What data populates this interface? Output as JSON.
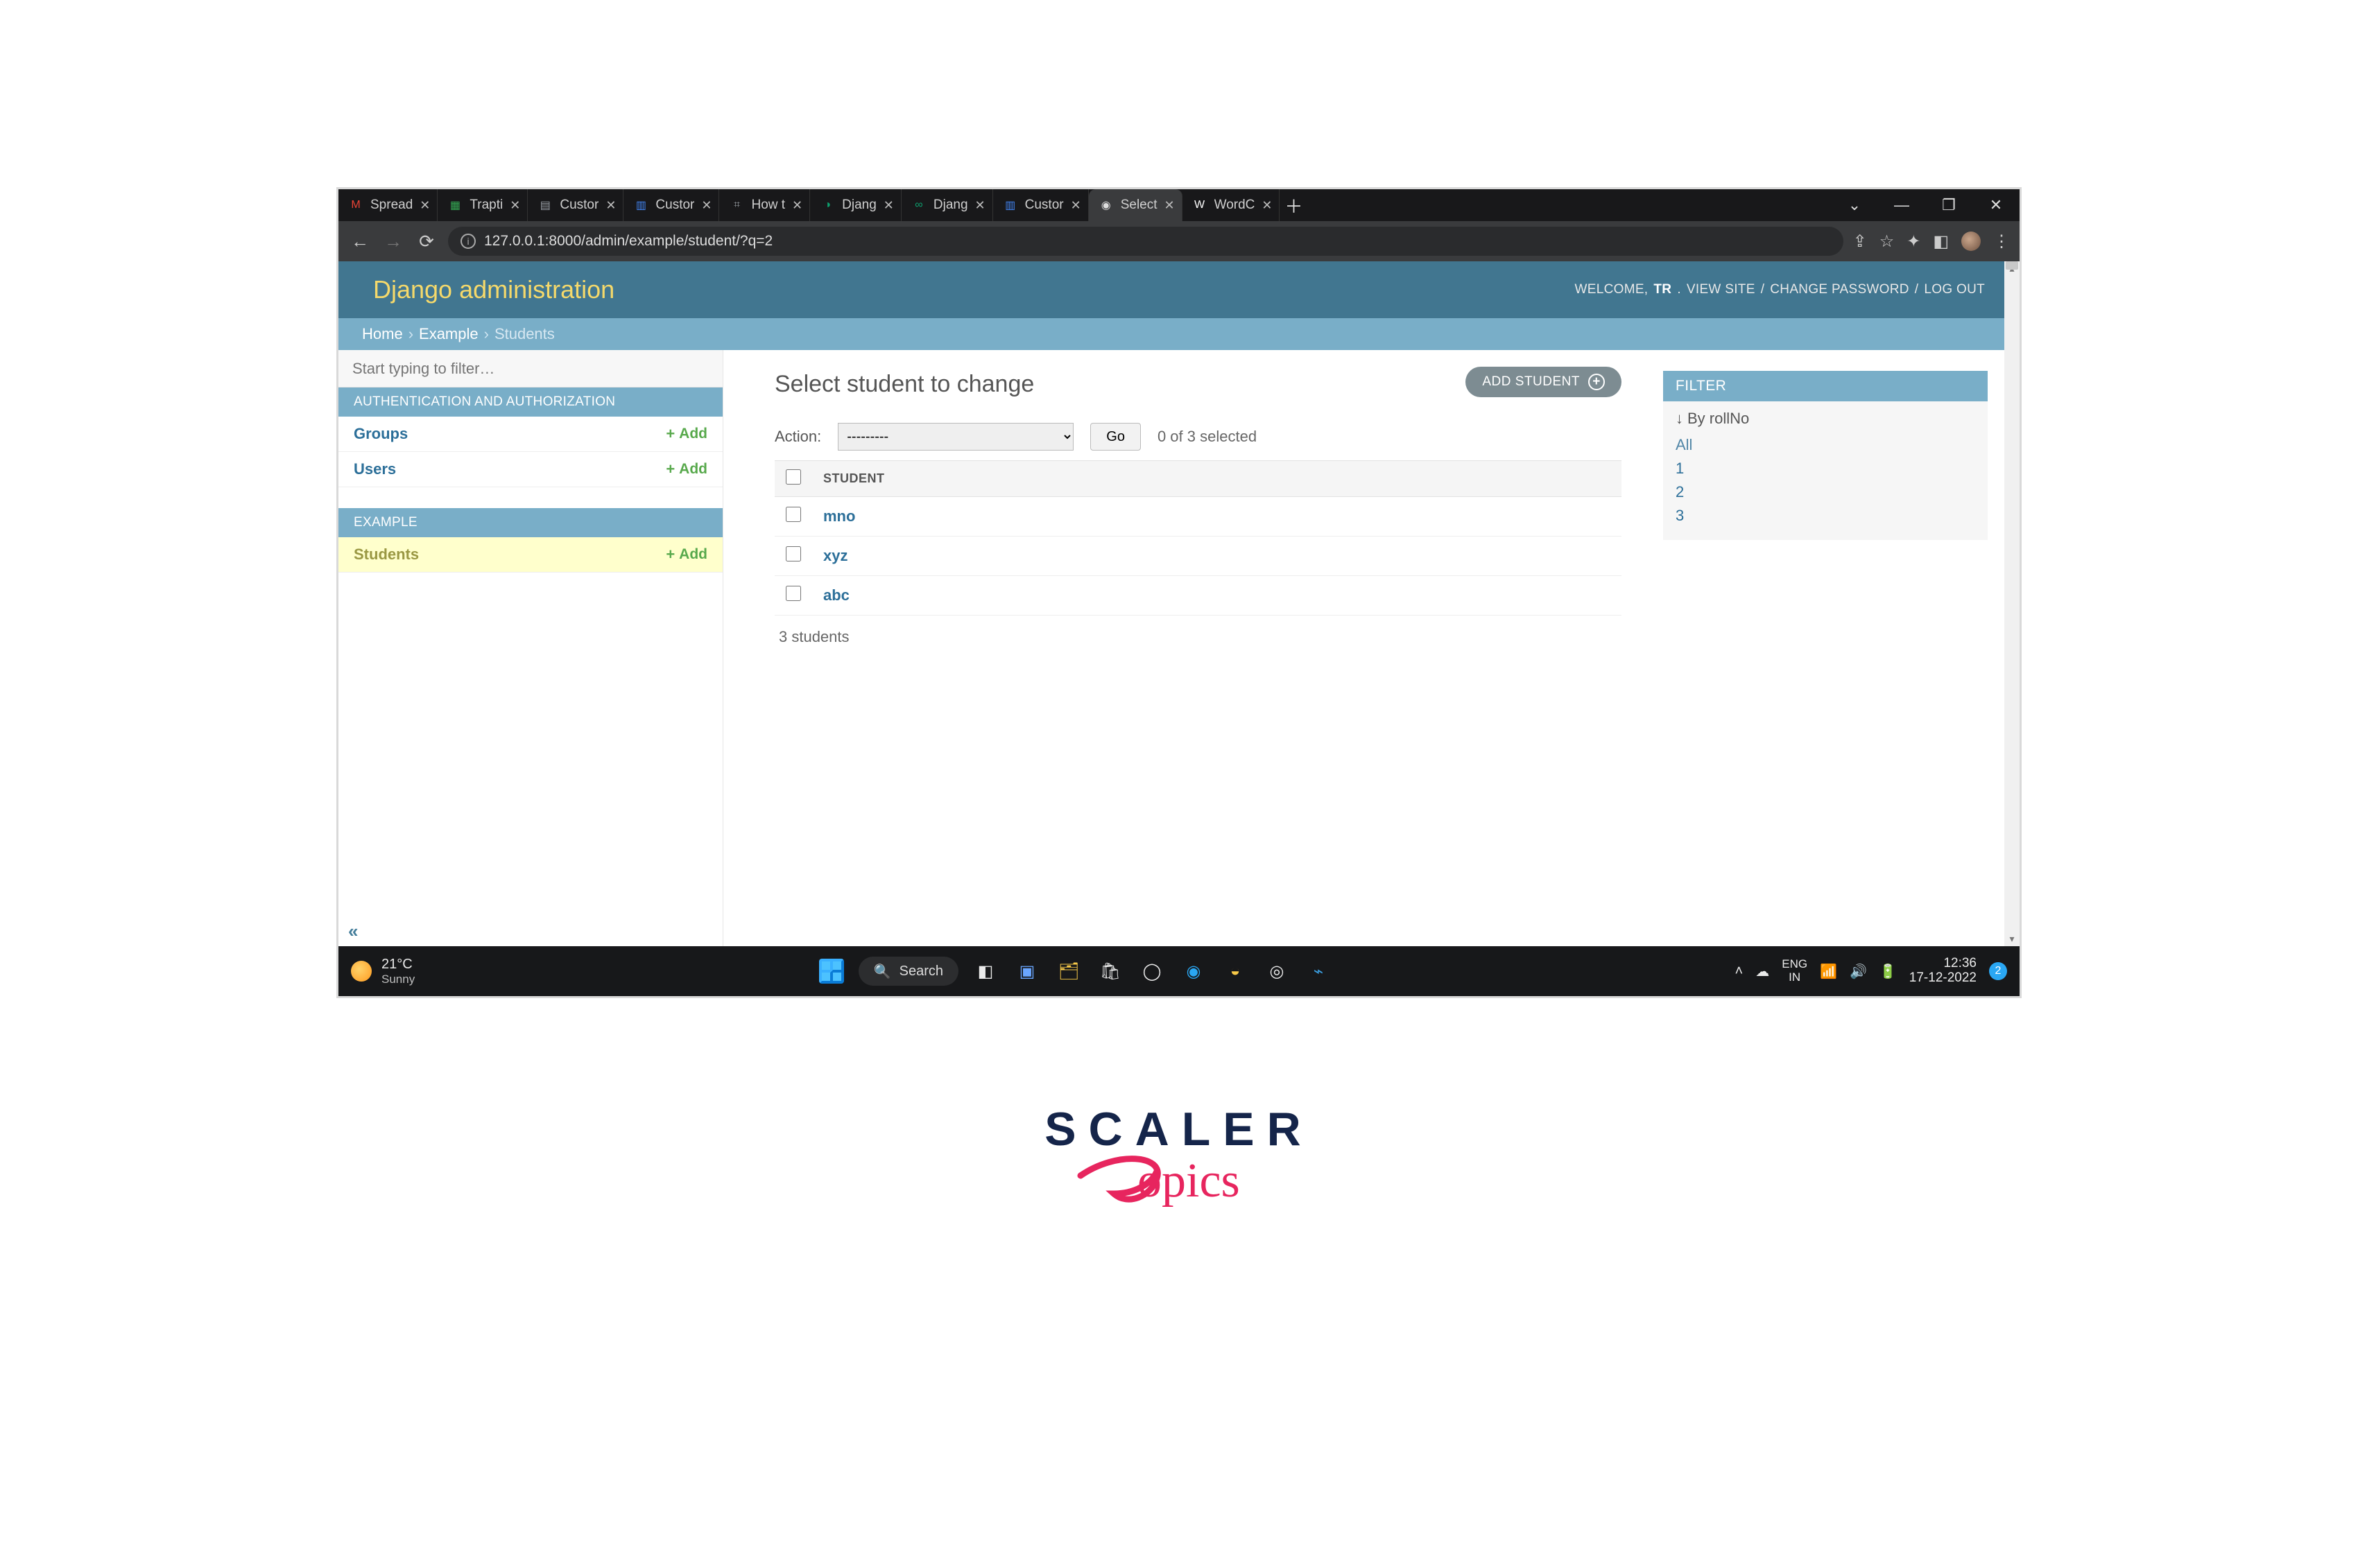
{
  "browser": {
    "tabs": [
      {
        "icon": "M",
        "color": "#ea4335",
        "label": "Spread"
      },
      {
        "icon": "▦",
        "color": "#34a853",
        "label": "Trapti"
      },
      {
        "icon": "▤",
        "color": "#9aa0a6",
        "label": "Custor"
      },
      {
        "icon": "▥",
        "color": "#4285f4",
        "label": "Custor"
      },
      {
        "icon": "⌗",
        "color": "#9aa0a6",
        "label": "How t"
      },
      {
        "icon": "◑",
        "color": "#0d9f6e",
        "label": "Djang"
      },
      {
        "icon": "∞",
        "color": "#0d9f6e",
        "label": "Djang"
      },
      {
        "icon": "▥",
        "color": "#4285f4",
        "label": "Custor"
      },
      {
        "icon": "◉",
        "color": "#ddd",
        "label": "Select",
        "active": true
      },
      {
        "icon": "W",
        "color": "#fff",
        "label": "WordC"
      }
    ],
    "url": "127.0.0.1:8000/admin/example/student/?q=2"
  },
  "header": {
    "brand": "Django administration",
    "welcome": "WELCOME,",
    "username": "TR",
    "view_site": "VIEW SITE",
    "change_password": "CHANGE PASSWORD",
    "logout": "LOG OUT"
  },
  "breadcrumbs": {
    "home": "Home",
    "app": "Example",
    "current": "Students"
  },
  "sidebar": {
    "filter_placeholder": "Start typing to filter…",
    "sections": [
      {
        "title": "AUTHENTICATION AND AUTHORIZATION",
        "models": [
          {
            "name": "Groups",
            "add": "Add"
          },
          {
            "name": "Users",
            "add": "Add"
          }
        ]
      },
      {
        "title": "EXAMPLE",
        "models": [
          {
            "name": "Students",
            "add": "Add",
            "selected": true
          }
        ]
      }
    ],
    "collapse": "«"
  },
  "content": {
    "title": "Select student to change",
    "add_btn": "ADD STUDENT",
    "action_label": "Action:",
    "action_placeholder": "---------",
    "go": "Go",
    "selection_count": "0 of 3 selected",
    "column_header": "STUDENT",
    "rows": [
      "mno",
      "xyz",
      "abc"
    ],
    "count_summary": "3 students"
  },
  "filter": {
    "heading": "FILTER",
    "by_label": "By rollNo",
    "options": [
      "All",
      "1",
      "2",
      "3"
    ],
    "active": "All"
  },
  "taskbar": {
    "temp": "21°C",
    "condition": "Sunny",
    "search": "Search",
    "lang1": "ENG",
    "lang2": "IN",
    "time": "12:36",
    "date": "17-12-2022",
    "notif": "2"
  },
  "scaler": {
    "word": "SCALER",
    "topics": "Topics"
  }
}
